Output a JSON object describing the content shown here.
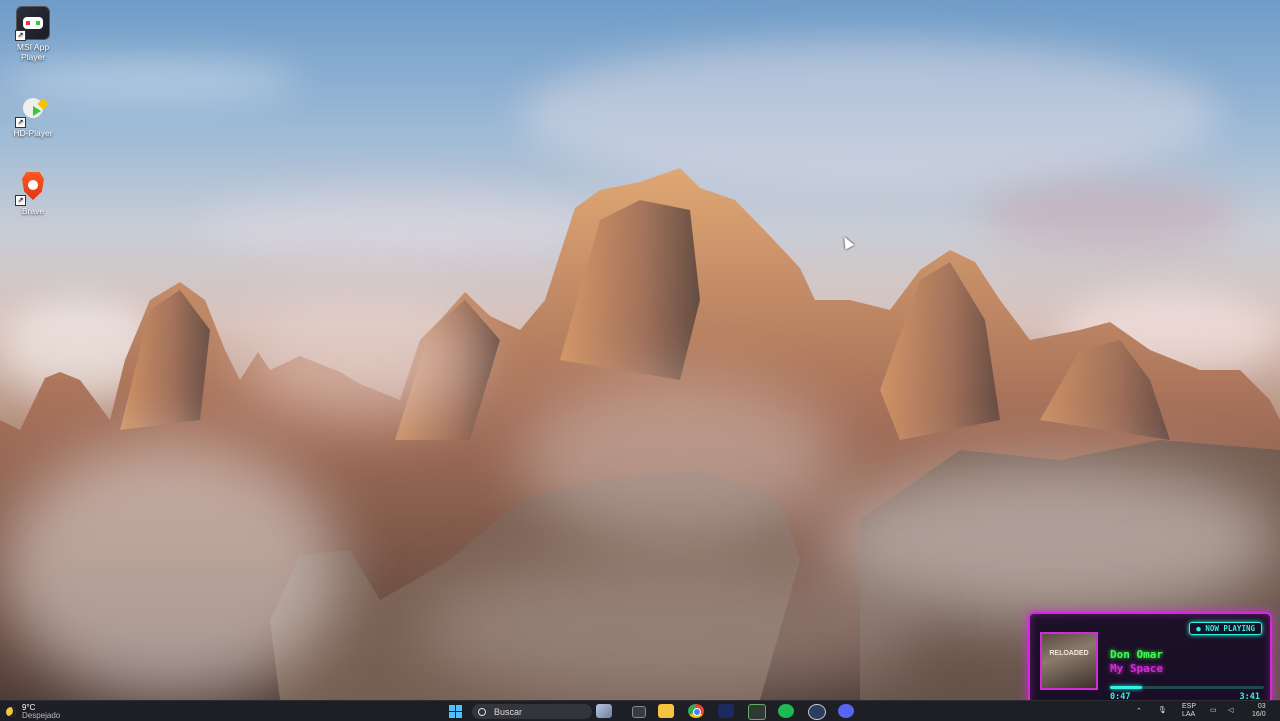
{
  "desktop": {
    "icons": [
      {
        "label": "MSI App Player",
        "icon": "msi-app-player-icon"
      },
      {
        "label": "HD-Player",
        "icon": "hd-player-icon"
      },
      {
        "label": "Brave",
        "icon": "brave-icon"
      }
    ]
  },
  "now_playing": {
    "badge": "● NOW PLAYING",
    "album_text": "RELOADED",
    "artist": "Don Omar",
    "title": "My Space",
    "elapsed": "0:47",
    "duration": "3:41",
    "progress": 0.21,
    "colors": {
      "border": "#d22bd8",
      "accent": "#2ff6e0",
      "artist": "#39ff4a"
    }
  },
  "taskbar": {
    "weather": {
      "temp": "9°C",
      "condition": "Despejado"
    },
    "search_placeholder": "Buscar",
    "pinned": [
      "start-icon",
      "task-view-icon",
      "file-explorer-icon",
      "chrome-icon",
      "app-icon",
      "app-icon-2",
      "spotify-icon",
      "steam-icon",
      "discord-icon"
    ],
    "tray": {
      "lang": "ESP",
      "lang_sub": "LAA",
      "time": "03",
      "date": "16/0"
    }
  }
}
